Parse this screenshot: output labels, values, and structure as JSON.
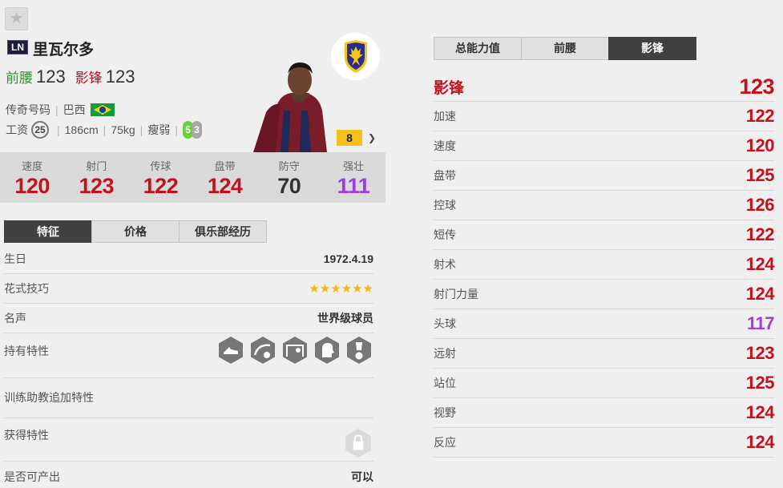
{
  "favorite": {
    "icon": "star-icon",
    "glyph": "★"
  },
  "player": {
    "season_badge": "LN",
    "name": "里瓦尔多",
    "positions": [
      {
        "name": "前腰",
        "value": "123",
        "color": "#2a9b2a"
      },
      {
        "name": "影锋",
        "value": "123",
        "color": "#c2121d"
      }
    ],
    "info_line1": {
      "season": "传奇号码",
      "nation": "巴西"
    },
    "info_line2": {
      "salary_label": "工资",
      "salary": "25",
      "height": "186cm",
      "weight": "75kg",
      "build": "瘦弱",
      "left_foot": "5",
      "right_foot": "3"
    },
    "enhance_level": "8",
    "club_logo": "club-crest-icon"
  },
  "main_stats": [
    {
      "label": "速度",
      "value": "120",
      "color": "#c2121d"
    },
    {
      "label": "射门",
      "value": "123",
      "color": "#c2121d"
    },
    {
      "label": "传球",
      "value": "122",
      "color": "#c2121d"
    },
    {
      "label": "盘带",
      "value": "124",
      "color": "#c2121d"
    },
    {
      "label": "防守",
      "value": "70",
      "color": "#333333"
    },
    {
      "label": "强壮",
      "value": "111",
      "color": "#9b3fe0"
    }
  ],
  "left_tabs": [
    {
      "label": "特征",
      "active": true
    },
    {
      "label": "价格",
      "active": false
    },
    {
      "label": "俱乐部经历",
      "active": false
    }
  ],
  "info": {
    "birthday": {
      "label": "生日",
      "value": "1972.4.19"
    },
    "skill": {
      "label": "花式技巧",
      "stars": "★★★★★★",
      "count": 6
    },
    "reputation": {
      "label": "名声",
      "value": "世界级球员"
    },
    "traits": {
      "label": "持有特性",
      "icons": [
        "boot-trait-icon",
        "curve-ball-trait-icon",
        "goal-trait-icon",
        "head-trait-icon",
        "trophy-trait-icon"
      ]
    },
    "coach_traits": {
      "label": "训练助教追加特性"
    },
    "earned_traits": {
      "label": "获得特性",
      "icon": "lock-icon"
    },
    "producible": {
      "label": "是否可产出",
      "value": "可以"
    }
  },
  "right_tabs": [
    {
      "label": "总能力值",
      "active": false
    },
    {
      "label": "前腰",
      "active": false
    },
    {
      "label": "影锋",
      "active": true
    }
  ],
  "attributes": {
    "header": {
      "name": "影锋",
      "value": "123",
      "color": "#c2121d"
    },
    "rows": [
      {
        "name": "加速",
        "value": "122",
        "color": "#c2121d"
      },
      {
        "name": "速度",
        "value": "120",
        "color": "#c2121d"
      },
      {
        "name": "盘带",
        "value": "125",
        "color": "#c2121d"
      },
      {
        "name": "控球",
        "value": "126",
        "color": "#c2121d"
      },
      {
        "name": "短传",
        "value": "122",
        "color": "#c2121d"
      },
      {
        "name": "射术",
        "value": "124",
        "color": "#c2121d"
      },
      {
        "name": "射门力量",
        "value": "124",
        "color": "#c2121d"
      },
      {
        "name": "头球",
        "value": "117",
        "color": "#9b3fe0"
      },
      {
        "name": "远射",
        "value": "123",
        "color": "#c2121d"
      },
      {
        "name": "站位",
        "value": "125",
        "color": "#c2121d"
      },
      {
        "name": "视野",
        "value": "124",
        "color": "#c2121d"
      },
      {
        "name": "反应",
        "value": "124",
        "color": "#c2121d"
      }
    ]
  }
}
